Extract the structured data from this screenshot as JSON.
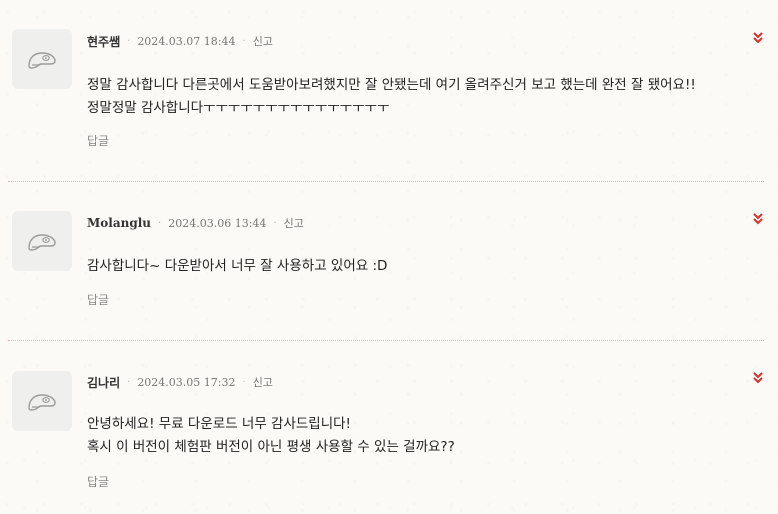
{
  "comments": [
    {
      "author": "현주쌤",
      "date": "2024.03.07 18:44",
      "report_label": "신고",
      "body_lines": [
        "정말 감사합니다 다른곳에서 도움받아보려했지만 잘 안됐는데 여기 올려주신거 보고 했는데 완전 잘 됐어요!!",
        "정말정말 감사합니다ㅜㅜㅜㅜㅜㅜㅜㅜㅜㅜㅜㅜㅜㅜㅜ"
      ],
      "reply_label": "답글"
    },
    {
      "author": "Molanglu",
      "date": "2024.03.06 13:44",
      "report_label": "신고",
      "body_lines": [
        "감사합니다~ 다운받아서 너무 잘 사용하고 있어요 :D"
      ],
      "reply_label": "답글"
    },
    {
      "author": "김나리",
      "date": "2024.03.05 17:32",
      "report_label": "신고",
      "body_lines": [
        "안녕하세요! 무료 다운로드 너무 감사드립니다!",
        "혹시 이 버전이 체험판 버전이 아닌 평생 사용할 수 있는 걸까요??"
      ],
      "reply_label": "답글"
    }
  ],
  "icons": {
    "avatar": "default-avatar-icon",
    "expand": "double-chevron-down-icon"
  },
  "colors": {
    "background": "#fbfaf6",
    "accent": "#d9302b",
    "divider": "#e3b6b6"
  }
}
